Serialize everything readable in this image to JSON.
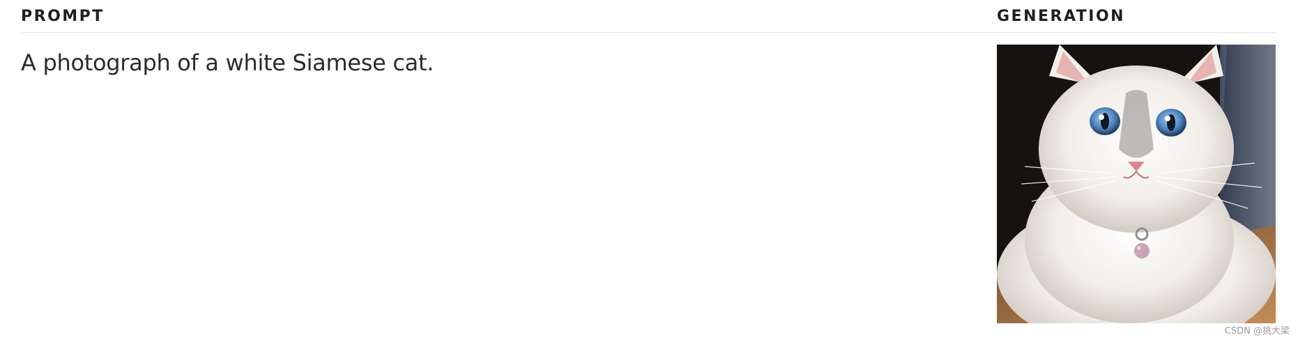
{
  "headers": {
    "prompt": "PROMPT",
    "generation": "GENERATION"
  },
  "prompt": {
    "text": "A photograph of a white Siamese cat."
  },
  "generation": {
    "image_subject": "white-siamese-cat-photo"
  },
  "watermark": {
    "text": "CSDN @挑大梁"
  }
}
